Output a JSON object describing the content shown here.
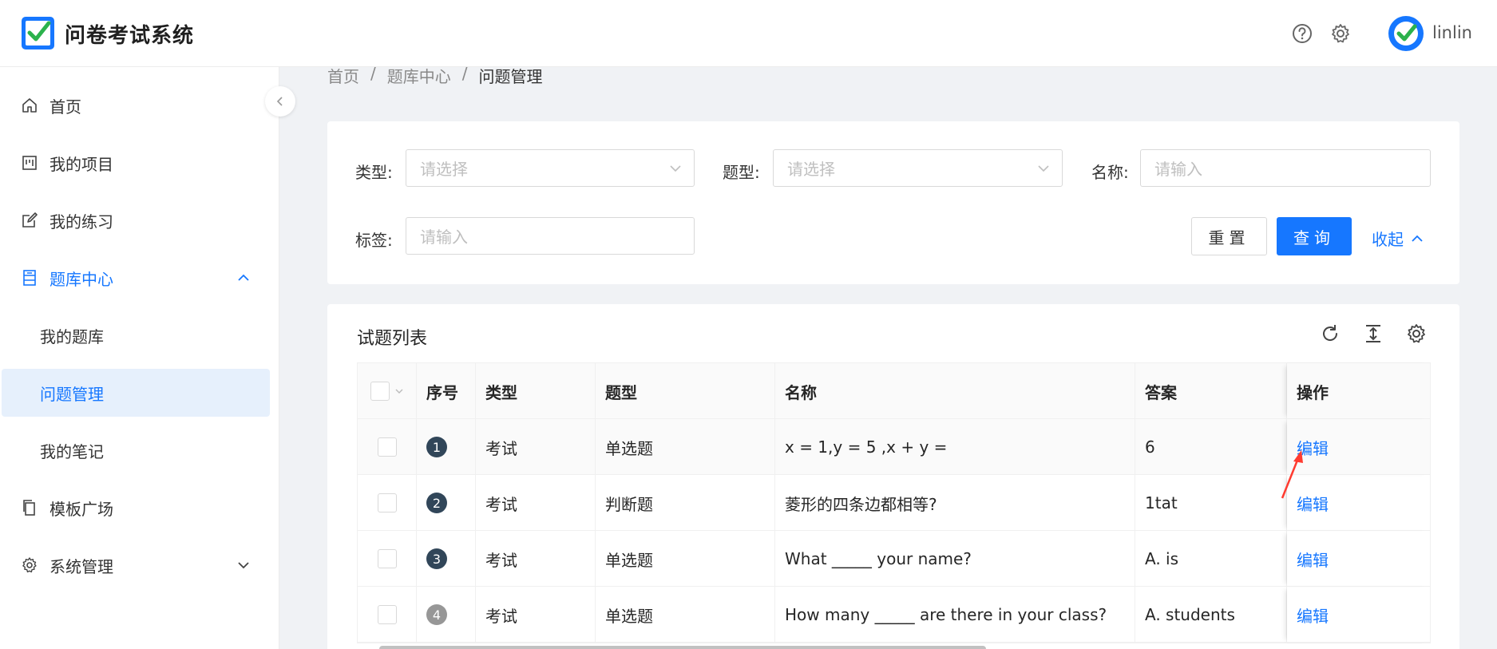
{
  "header": {
    "app_title": "问卷考试系统",
    "username": "linlin",
    "icons": [
      "help-icon",
      "gear-icon"
    ]
  },
  "sidebar": {
    "items": [
      {
        "label": "首页",
        "icon": "home-icon"
      },
      {
        "label": "我的项目",
        "icon": "project-icon"
      },
      {
        "label": "我的练习",
        "icon": "edit-icon"
      },
      {
        "label": "题库中心",
        "icon": "database-icon",
        "expanded": true
      },
      {
        "label": "我的题库"
      },
      {
        "label": "问题管理",
        "selected": true
      },
      {
        "label": "我的笔记"
      },
      {
        "label": "模板广场",
        "icon": "copy-icon"
      },
      {
        "label": "系统管理",
        "icon": "gear-icon",
        "expanded": false
      }
    ]
  },
  "breadcrumb": [
    "首页",
    "题库中心",
    "问题管理"
  ],
  "breadcrumb_sep": "/",
  "filters": {
    "type_label": "类型:",
    "type_placeholder": "请选择",
    "qtype_label": "题型:",
    "qtype_placeholder": "请选择",
    "name_label": "名称:",
    "name_placeholder": "请输入",
    "tag_label": "标签:",
    "tag_placeholder": "请输入",
    "reset": "重置",
    "query": "查询",
    "collapse": "收起"
  },
  "table": {
    "title": "试题列表",
    "columns": [
      "序号",
      "类型",
      "题型",
      "名称",
      "答案",
      "操作"
    ],
    "rows": [
      {
        "index": "1",
        "type": "考试",
        "qtype": "单选题",
        "name": "x = 1,y = 5 ,x + y =",
        "answer": "6",
        "action": "编辑"
      },
      {
        "index": "2",
        "type": "考试",
        "qtype": "判断题",
        "name": "菱形的四条边都相等?",
        "answer": "1tat",
        "action": "编辑"
      },
      {
        "index": "3",
        "type": "考试",
        "qtype": "单选题",
        "name": "What _____ your name?",
        "answer": "A. is",
        "action": "编辑"
      },
      {
        "index": "4",
        "type": "考试",
        "qtype": "单选题",
        "name": "How many _____ are there in your class?",
        "answer": "A. students",
        "action": "编辑"
      }
    ]
  },
  "colors": {
    "accent": "#1677ff",
    "badge": "#314659",
    "badge_muted": "#979797",
    "annotation": "#ff3b30"
  }
}
